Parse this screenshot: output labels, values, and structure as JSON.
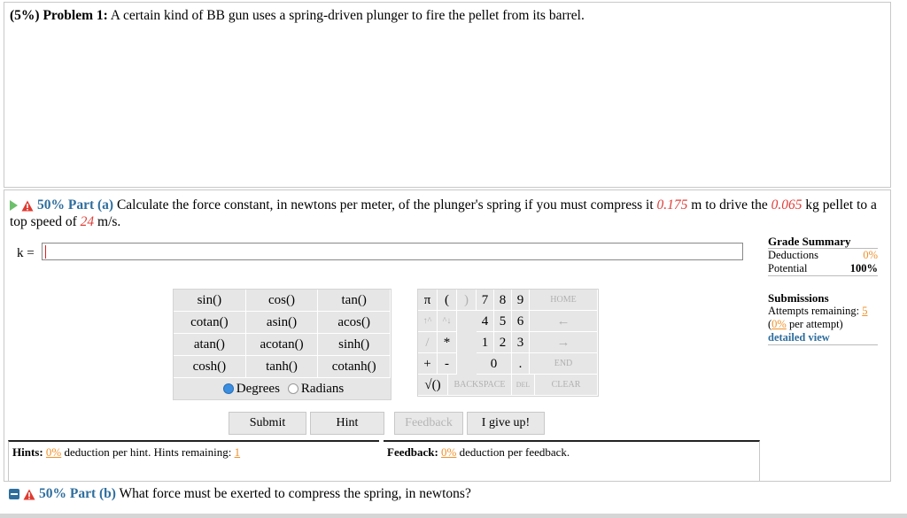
{
  "problem": {
    "prefix": "(5%) Problem 1:",
    "text": " A certain kind of BB gun uses a spring-driven plunger to fire the pellet from its barrel."
  },
  "part_a": {
    "label": "50% Part (a)",
    "text1": " Calculate the force constant, in newtons per meter, of the plunger's spring if you must compress it ",
    "compress": "0.175",
    "text2": " m to drive the ",
    "mass": "0.065",
    "text3": " kg pellet to a top speed of ",
    "speed": "24",
    "text4": " m/s.",
    "var_label": "k =",
    "input_value": ""
  },
  "grade_summary": {
    "title": "Grade Summary",
    "deductions_label": "Deductions",
    "deductions_value": "0%",
    "potential_label": "Potential",
    "potential_value": "100%"
  },
  "submissions": {
    "title": "Submissions",
    "attempts_label": "Attempts remaining:",
    "attempts_value": "5",
    "per_attempt_pct": "0%",
    "per_attempt_label": " per attempt)",
    "detailed_view": "detailed view"
  },
  "functions": {
    "rows": [
      [
        "sin()",
        "cos()",
        "tan()"
      ],
      [
        "cotan()",
        "asin()",
        "acos()"
      ],
      [
        "atan()",
        "acotan()",
        "sinh()"
      ],
      [
        "cosh()",
        "tanh()",
        "cotanh()"
      ]
    ],
    "degrees": "Degrees",
    "radians": "Radians"
  },
  "keypad": {
    "pi": "π",
    "lparen": "(",
    "rparen": ")",
    "k7": "7",
    "k8": "8",
    "k9": "9",
    "home": "HOME",
    "up": "↑^",
    "down": "^↓",
    "k4": "4",
    "k5": "5",
    "k6": "6",
    "left": "←",
    "slash": "/",
    "star": "*",
    "k1": "1",
    "k2": "2",
    "k3": "3",
    "right": "→",
    "plus": "+",
    "minus": "-",
    "k0": "0",
    "dot": ".",
    "end": "END",
    "sqrt": "√()",
    "backspace": "BACKSPACE",
    "del": "DEL",
    "clear": "CLEAR"
  },
  "buttons": {
    "submit": "Submit",
    "hint": "Hint",
    "feedback": "Feedback",
    "giveup": "I give up!"
  },
  "hints": {
    "label": "Hints:",
    "pct": "0%",
    "text": " deduction per hint. Hints remaining: ",
    "remaining": "1"
  },
  "feedback": {
    "label": "Feedback:",
    "pct": "0%",
    "text": " deduction per feedback."
  },
  "part_b": {
    "label": "50% Part (b)",
    "text": " What force must be exerted to compress the spring, in newtons?"
  },
  "colors": {
    "part_label": "#2e6e9e",
    "given_values": "#e0403a",
    "orange": "#f0902a"
  }
}
